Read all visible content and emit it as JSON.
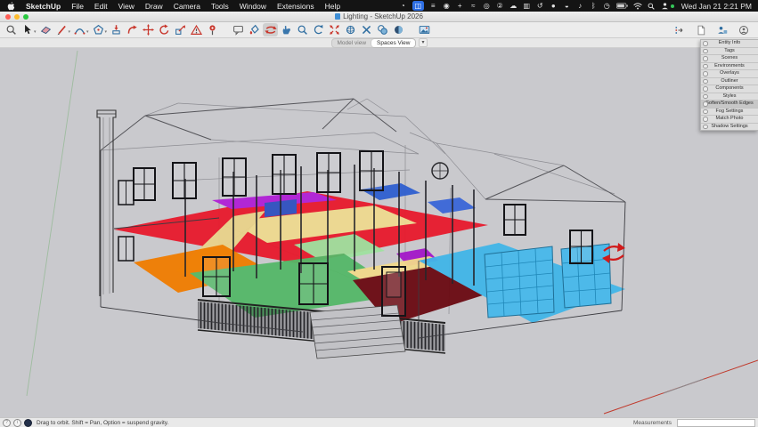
{
  "menubar": {
    "items": [
      "SketchUp",
      "File",
      "Edit",
      "View",
      "Draw",
      "Camera",
      "Tools",
      "Window",
      "Extensions",
      "Help"
    ],
    "status_icons": [
      {
        "name": "sync-icon",
        "glyph": "◔"
      },
      {
        "name": "screen-indicator-icon",
        "glyph": "◫"
      },
      {
        "name": "window-tiling-icon",
        "glyph": "≡"
      },
      {
        "name": "record-icon",
        "glyph": "◉"
      },
      {
        "name": "plus-icon",
        "glyph": "+"
      },
      {
        "name": "activity-icon",
        "glyph": "≈"
      },
      {
        "name": "camera-icon",
        "glyph": "◎"
      },
      {
        "name": "notification-count-icon",
        "glyph": "②"
      },
      {
        "name": "cloud-icon",
        "glyph": "☁"
      },
      {
        "name": "displays-icon",
        "glyph": "▥"
      },
      {
        "name": "history-icon",
        "glyph": "↺"
      },
      {
        "name": "app-dot-icon",
        "glyph": "●"
      },
      {
        "name": "shield-icon",
        "glyph": "◒"
      },
      {
        "name": "volume-icon",
        "glyph": "♪"
      },
      {
        "name": "bluetooth-icon",
        "glyph": "ᛒ"
      },
      {
        "name": "clock-menu-icon",
        "glyph": "◷"
      }
    ],
    "clock": "Wed Jan 21  2:21 PM"
  },
  "titlebar": {
    "title": "Lighting - SketchUp 2026"
  },
  "toolbar": {
    "tools": [
      "search",
      "select",
      "eraser",
      "line",
      "arc",
      "shapes",
      "push-pull",
      "follow-me",
      "move",
      "rotate",
      "scale",
      "warning",
      "position-pin",
      "annotation",
      "paint-bucket",
      "orbit",
      "pan",
      "zoom",
      "previous-view",
      "zoom-extents",
      "position-camera",
      "walk",
      "sections",
      "style-sphere",
      "match-photo"
    ],
    "active_tool": "orbit",
    "right_tools": [
      "export",
      "new-document",
      "collaborate",
      "account"
    ]
  },
  "viewbar": {
    "inactive": "Model view",
    "active": "Spaces View",
    "caret": "▾"
  },
  "tray": {
    "items": [
      "Entity Info",
      "Tags",
      "Scenes",
      "Environments",
      "Overlays",
      "Outliner",
      "Components",
      "Styles",
      "Soften/Smooth Edges",
      "Fog Settings",
      "Match Photo",
      "Shadow Settings"
    ],
    "active_item": "Soften/Smooth Edges"
  },
  "statusbar": {
    "hint": "Drag to orbit. Shift = Pan, Option = suspend gravity.",
    "measurements_label": "Measurements",
    "measurements_value": ""
  },
  "viewport": {
    "background": "#c9c9cd",
    "axis_green": "#90b890",
    "axis_red": "#c0392b",
    "zones": [
      {
        "name": "upper-floor-red",
        "color": "#e81a2c"
      },
      {
        "name": "hall-purple",
        "color": "#b01fd6"
      },
      {
        "name": "closet-purple-small",
        "color": "#a418c8"
      },
      {
        "name": "stair-khaki",
        "color": "#eed98f"
      },
      {
        "name": "landing-khaki",
        "color": "#e9d28a"
      },
      {
        "name": "bath-blue-1",
        "color": "#2f5fd0"
      },
      {
        "name": "bath-blue-2",
        "color": "#3a66d8"
      },
      {
        "name": "bed-blue-rect",
        "color": "#3050c0"
      },
      {
        "name": "kitchen-orange",
        "color": "#f07d00"
      },
      {
        "name": "living-green",
        "color": "#55b868"
      },
      {
        "name": "pantry-light-green",
        "color": "#9fe2a0"
      },
      {
        "name": "dining-yellow",
        "color": "#f2d98b"
      },
      {
        "name": "theater-maroon",
        "color": "#6b0a12"
      },
      {
        "name": "garage-cyan",
        "color": "#41b6e8"
      },
      {
        "name": "garage-door-cyan",
        "color": "#4db9e9"
      }
    ]
  }
}
